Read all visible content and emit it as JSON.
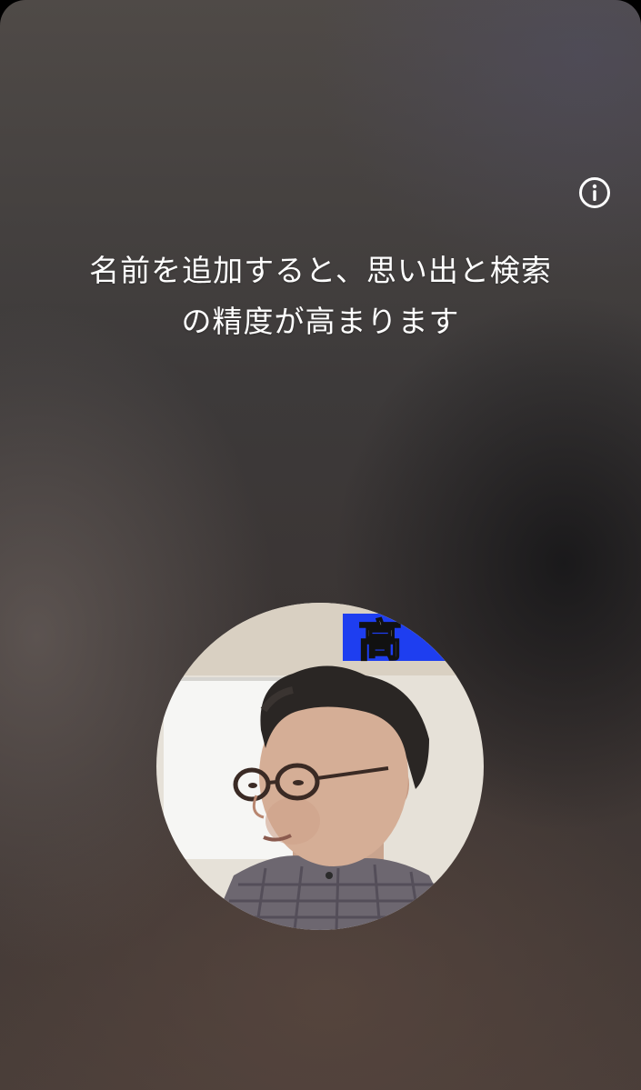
{
  "info": {
    "icon": "info-icon",
    "color": "#ffffff"
  },
  "message": {
    "line1": "名前を追加すると、思い出と検索",
    "line2": "の精度が高まります"
  },
  "avatar": {
    "sign_text": "高",
    "sign_color": "#1e3ef0"
  }
}
